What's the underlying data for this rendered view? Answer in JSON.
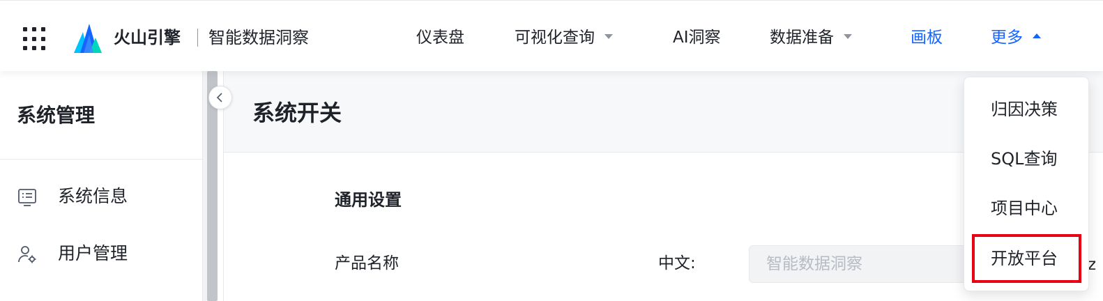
{
  "topbar": {
    "brand": "火山引擎",
    "product": "智能数据洞察",
    "nav": [
      {
        "label": "仪表盘",
        "dropdown": false,
        "active": false
      },
      {
        "label": "可视化查询",
        "dropdown": true,
        "active": false
      },
      {
        "label": "AI洞察",
        "dropdown": false,
        "active": false
      },
      {
        "label": "数据准备",
        "dropdown": true,
        "active": false
      },
      {
        "label": "画板",
        "dropdown": false,
        "active": true
      },
      {
        "label": "更多",
        "dropdown": true,
        "active": true
      }
    ],
    "accent_color": "#1664ff"
  },
  "sidebar": {
    "title": "系统管理",
    "items": [
      {
        "label": "系统信息",
        "icon": "system-info-icon"
      },
      {
        "label": "用户管理",
        "icon": "user-settings-icon"
      }
    ]
  },
  "main": {
    "page_title": "系统开关",
    "section_title": "通用设置",
    "field_label": "产品名称",
    "lang_label": "中文:",
    "input_placeholder": "智能数据洞察",
    "peek_char": "z"
  },
  "more_menu": {
    "items": [
      "归因决策",
      "SQL查询",
      "项目中心",
      "开放平台"
    ],
    "highlighted": "开放平台",
    "highlight_color": "#e60012"
  }
}
